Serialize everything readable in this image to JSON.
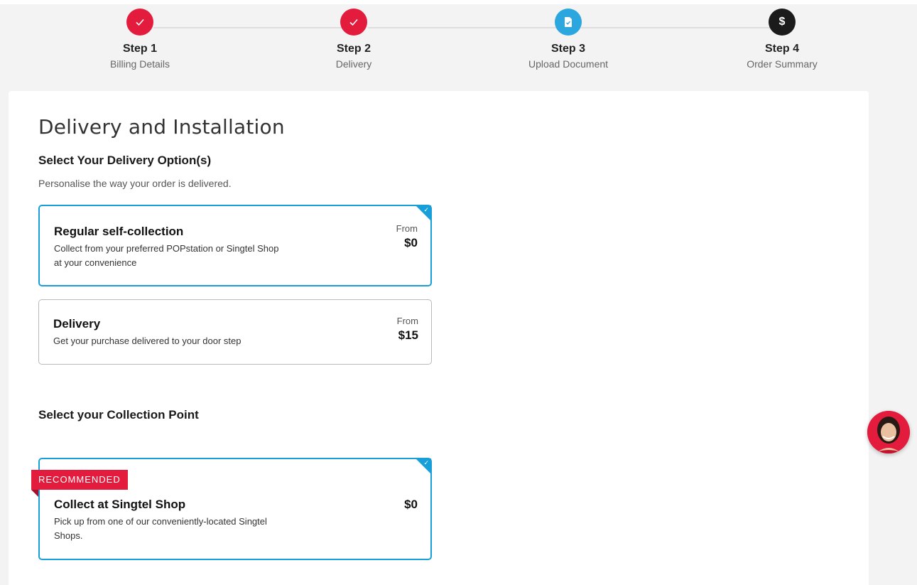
{
  "steps": [
    {
      "title": "Step 1",
      "subtitle": "Billing Details",
      "status": "done",
      "icon": "check-icon"
    },
    {
      "title": "Step 2",
      "subtitle": "Delivery",
      "status": "done",
      "icon": "check-icon"
    },
    {
      "title": "Step 3",
      "subtitle": "Upload Document",
      "status": "current",
      "icon": "document-icon"
    },
    {
      "title": "Step 4",
      "subtitle": "Order Summary",
      "status": "pending",
      "icon": "dollar-icon",
      "icon_text": "$"
    }
  ],
  "main": {
    "title": "Delivery and Installation",
    "delivery_section": {
      "heading": "Select Your Delivery Option(s)",
      "description": "Personalise the way your order is delivered.",
      "options": [
        {
          "title": "Regular self-collection",
          "description": "Collect from your preferred POPstation or Singtel Shop at your convenience",
          "price_prefix": "From",
          "price": "$0",
          "selected": true
        },
        {
          "title": "Delivery",
          "description": "Get your purchase delivered to your door step",
          "price_prefix": "From",
          "price": "$15",
          "selected": false
        }
      ]
    },
    "collection_section": {
      "heading": "Select your Collection Point",
      "options": [
        {
          "badge": "RECOMMENDED",
          "title": "Collect at Singtel Shop",
          "description": "Pick up from one of our conveniently-located Singtel Shops.",
          "price": "$0",
          "selected": true
        }
      ]
    }
  },
  "chat": {
    "icon": "chat-agent-avatar-icon"
  },
  "colors": {
    "brand_red": "#e31c3d",
    "accent_blue": "#189fd9",
    "step_current": "#2ba6de",
    "step_pending": "#1b1b1b"
  }
}
